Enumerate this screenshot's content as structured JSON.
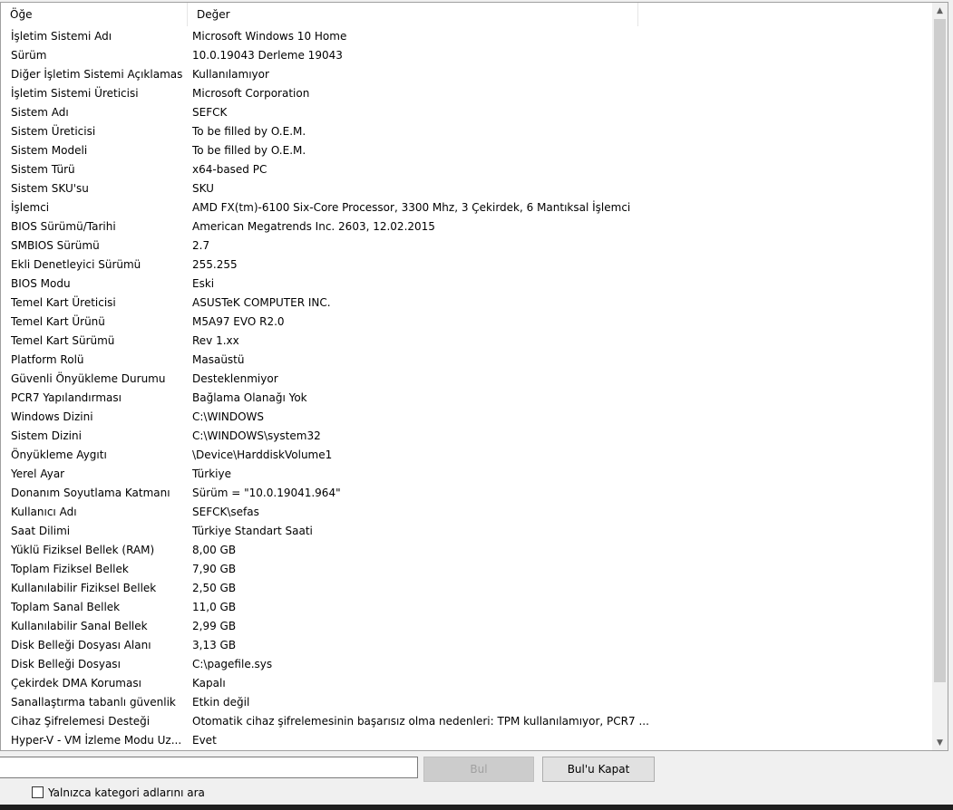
{
  "table": {
    "headers": [
      "Öğe",
      "Değer"
    ],
    "rows": [
      [
        "İşletim Sistemi Adı",
        "Microsoft Windows 10 Home"
      ],
      [
        "Sürüm",
        "10.0.19043 Derleme 19043"
      ],
      [
        "Diğer İşletim Sistemi Açıklaması",
        "Kullanılamıyor"
      ],
      [
        "İşletim Sistemi Üreticisi",
        "Microsoft Corporation"
      ],
      [
        "Sistem Adı",
        "SEFCK"
      ],
      [
        "Sistem Üreticisi",
        "To be filled by O.E.M."
      ],
      [
        "Sistem Modeli",
        "To be filled by O.E.M."
      ],
      [
        "Sistem Türü",
        "x64-based PC"
      ],
      [
        "Sistem SKU'su",
        "SKU"
      ],
      [
        "İşlemci",
        "AMD FX(tm)-6100 Six-Core Processor, 3300 Mhz, 3 Çekirdek, 6 Mantıksal İşlemci"
      ],
      [
        "BIOS Sürümü/Tarihi",
        "American Megatrends Inc. 2603, 12.02.2015"
      ],
      [
        "SMBIOS Sürümü",
        "2.7"
      ],
      [
        "Ekli Denetleyici Sürümü",
        "255.255"
      ],
      [
        "BIOS Modu",
        "Eski"
      ],
      [
        "Temel Kart Üreticisi",
        "ASUSTeK COMPUTER INC."
      ],
      [
        "Temel Kart Ürünü",
        "M5A97 EVO R2.0"
      ],
      [
        "Temel Kart Sürümü",
        "Rev 1.xx"
      ],
      [
        "Platform Rolü",
        "Masaüstü"
      ],
      [
        "Güvenli Önyükleme Durumu",
        "Desteklenmiyor"
      ],
      [
        "PCR7 Yapılandırması",
        "Bağlama Olanağı Yok"
      ],
      [
        "Windows Dizini",
        "C:\\WINDOWS"
      ],
      [
        "Sistem Dizini",
        "C:\\WINDOWS\\system32"
      ],
      [
        "Önyükleme Aygıtı",
        "\\Device\\HarddiskVolume1"
      ],
      [
        "Yerel Ayar",
        "Türkiye"
      ],
      [
        "Donanım Soyutlama Katmanı",
        "Sürüm = \"10.0.19041.964\""
      ],
      [
        "Kullanıcı Adı",
        "SEFCK\\sefas"
      ],
      [
        "Saat Dilimi",
        "Türkiye Standart Saati"
      ],
      [
        "Yüklü Fiziksel Bellek (RAM)",
        "8,00 GB"
      ],
      [
        "Toplam Fiziksel Bellek",
        "7,90 GB"
      ],
      [
        "Kullanılabilir Fiziksel Bellek",
        "2,50 GB"
      ],
      [
        "Toplam Sanal Bellek",
        "11,0 GB"
      ],
      [
        "Kullanılabilir Sanal Bellek",
        "2,99 GB"
      ],
      [
        "Disk Belleği Dosyası Alanı",
        "3,13 GB"
      ],
      [
        "Disk Belleği Dosyası",
        "C:\\pagefile.sys"
      ],
      [
        "Çekirdek DMA Koruması",
        "Kapalı"
      ],
      [
        "Sanallaştırma tabanlı güvenlik",
        "Etkin değil"
      ],
      [
        "Cihaz Şifrelemesi Desteği",
        "Otomatik cihaz şifrelemesinin başarısız olma nedenleri: TPM kullanılamıyor, PCR7 ..."
      ],
      [
        "Hyper-V - VM İzleme Modu Uz...",
        "Evet"
      ]
    ]
  },
  "search": {
    "value": "",
    "find_label": "Bul",
    "close_find_label": "Bul'u Kapat",
    "category_only_label": "Yalnızca kategori adlarını ara",
    "category_only_checked": false
  },
  "icons": {
    "scroll_up": "chevron-up-icon",
    "scroll_down": "chevron-down-icon"
  }
}
